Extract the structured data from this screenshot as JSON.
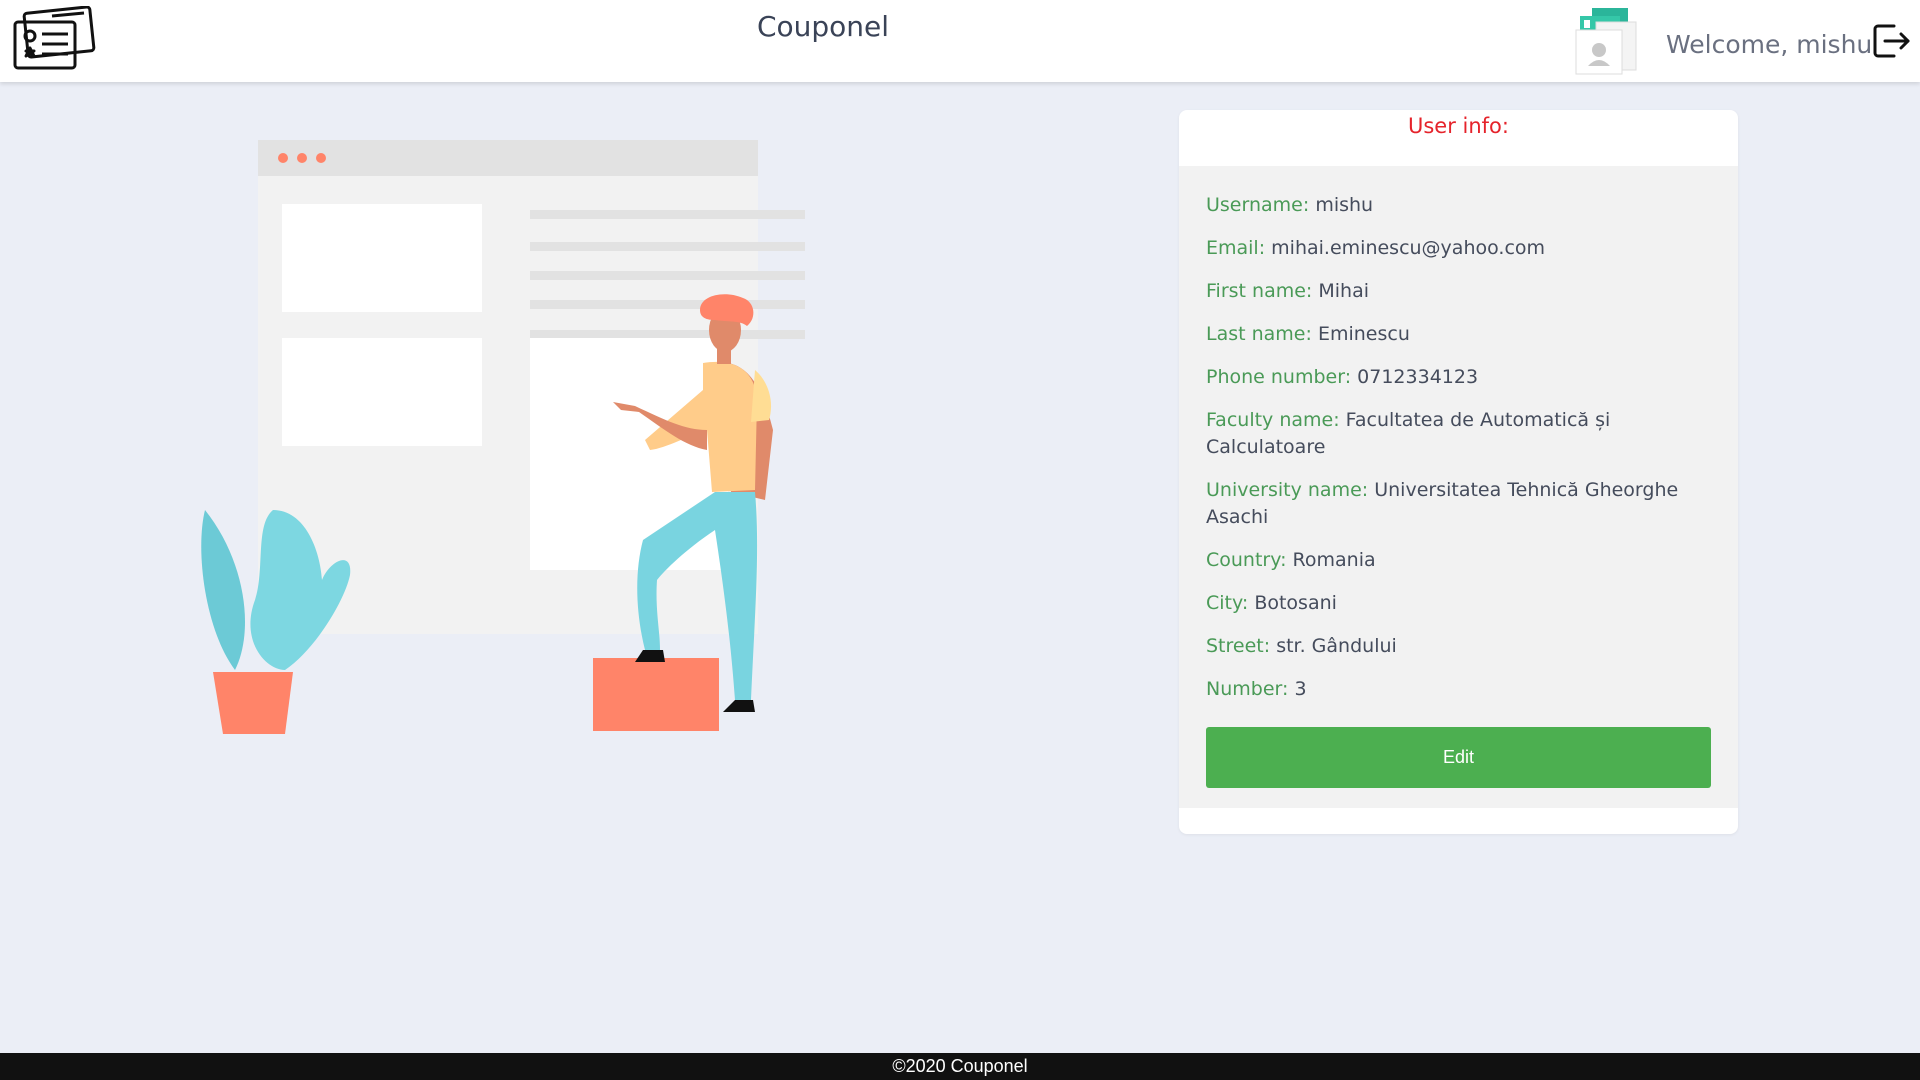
{
  "header": {
    "title": "Couponel",
    "welcome_text": "Welcome, mishu",
    "logo_icon": "coupon-logo-icon",
    "avatar_icon": "profile-cards-icon",
    "logout_icon": "logout-icon"
  },
  "user_info": {
    "title": "User info:",
    "fields": [
      {
        "label": "Username:",
        "value": "mishu"
      },
      {
        "label": "Email:",
        "value": "mihai.eminescu@yahoo.com"
      },
      {
        "label": "First name:",
        "value": "Mihai"
      },
      {
        "label": "Last name:",
        "value": "Eminescu"
      },
      {
        "label": "Phone number:",
        "value": "0712334123"
      },
      {
        "label": "Faculty name:",
        "value": "Facultatea de Automatică și Calculatoare"
      },
      {
        "label": "University name:",
        "value": "Universitatea Tehnică Gheorghe Asachi"
      },
      {
        "label": "Country:",
        "value": "Romania"
      },
      {
        "label": "City:",
        "value": "Botosani"
      },
      {
        "label": "Street:",
        "value": "str. Gândului"
      },
      {
        "label": "Number:",
        "value": "3"
      }
    ],
    "edit_label": "Edit"
  },
  "footer": {
    "text": "©2020 Couponel"
  },
  "colors": {
    "accent_green": "#4caf50",
    "label_green": "#4a9a57",
    "title_red": "#e5232b",
    "background": "#ebeef6"
  }
}
